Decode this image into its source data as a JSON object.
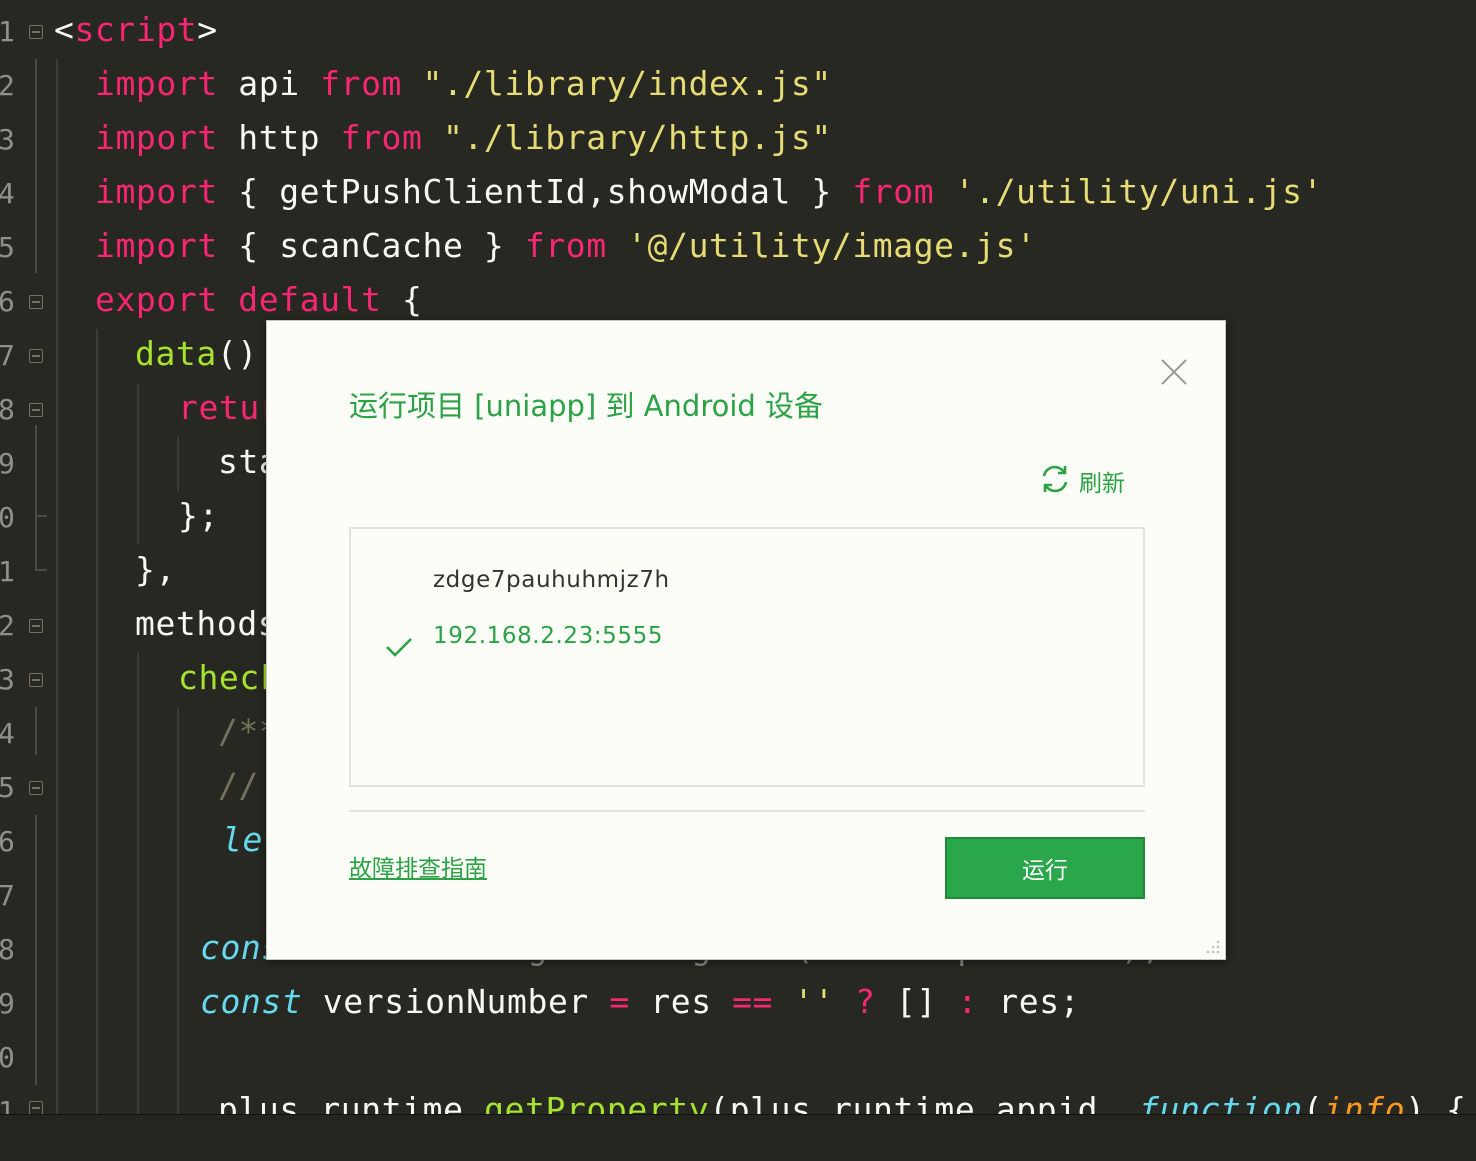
{
  "editor": {
    "line_numbers": [
      "1",
      "2",
      "3",
      "4",
      "5",
      "6",
      "7",
      "8",
      "9",
      "0",
      "1",
      "2",
      "3",
      "4",
      "5",
      "6",
      "7",
      "8",
      "9",
      "0",
      "1"
    ],
    "lines": {
      "l1": {
        "lt": "<",
        "tag": "script",
        "gt": ">"
      },
      "l2": {
        "import": "import",
        "name": " api ",
        "from": "from",
        "path": " \"./library/index.js\""
      },
      "l3": {
        "import": "import",
        "name": " http ",
        "from": "from",
        "path": " \"./library/http.js\""
      },
      "l4": {
        "import": "import",
        "names": " { getPushClientId,showModal } ",
        "from": "from",
        "path": " './utility/uni.js'"
      },
      "l5": {
        "import": "import",
        "names": " { scanCache } ",
        "from": "from",
        "path": " '@/utility/image.js'"
      },
      "l6": {
        "export": "export",
        "default": " default",
        "brace": " {"
      },
      "l7": {
        "fn": "data",
        "rest": "()"
      },
      "l8": {
        "kw": "retur"
      },
      "l9": {
        "text": "sta"
      },
      "l10": {
        "text": "};"
      },
      "l11": {
        "text": "},"
      },
      "l12": {
        "text": "methods"
      },
      "l13": {
        "fn": "check"
      },
      "l14": {
        "cm": "/**"
      },
      "l15": {
        "cm": "//"
      },
      "l16": {
        "it": "let"
      },
      "l18": {
        "it": "cons",
        "rest": "    ...    .get....ng....(   . ..p..  ...);"
      },
      "l19": {
        "it": "const",
        "name": " versionNumber ",
        "eq": "=",
        "res": " res ",
        "eqeq": "==",
        "empty": " ''",
        "q": " ?",
        "arr": " []",
        "colon": " :",
        "end": " res;"
      },
      "l21": {
        "obj": "plus.runtime.",
        "fn": "getProperty",
        "args": "(plus.runtime.appid, ",
        "func": "function",
        "paren": "(",
        "param": "info",
        "close": ") {"
      }
    }
  },
  "dialog": {
    "title": "运行项目 [uniapp] 到 Android 设备",
    "close_icon": "close-icon",
    "refresh_icon": "refresh-icon",
    "refresh_label": "刷新",
    "devices": [
      {
        "name": "zdge7pauhuhmjz7h",
        "selected": false
      },
      {
        "name": "192.168.2.23:5555",
        "selected": true
      }
    ],
    "troubleshoot_link": "故障排查指南",
    "run_button": "运行"
  },
  "colors": {
    "editor_bg": "#272822",
    "accent_green": "#2aa245",
    "keyword_pink": "#f92672",
    "string_yellow": "#e6db74",
    "function_green": "#a6e22e",
    "italic_cyan": "#66d9ef"
  }
}
